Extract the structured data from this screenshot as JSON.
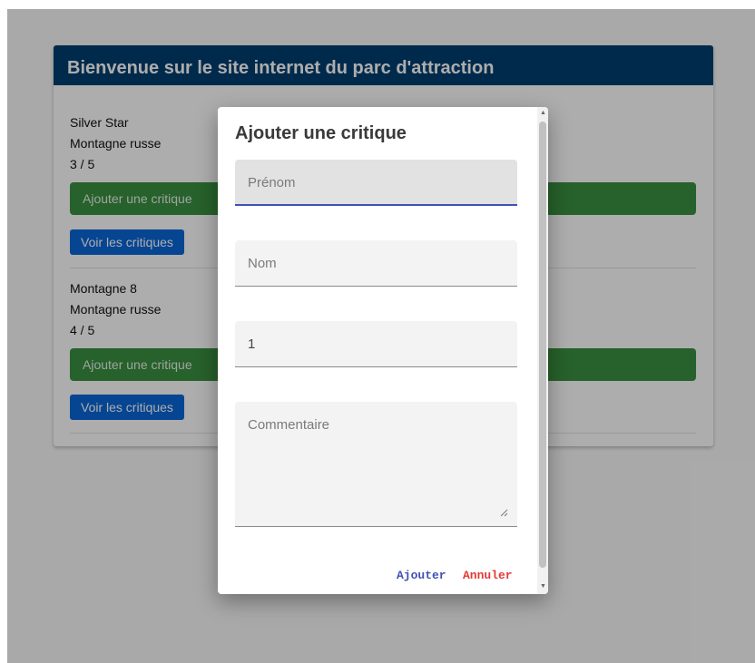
{
  "page": {
    "title": "Bienvenue sur le site internet du parc d'attraction",
    "attractions": [
      {
        "name": "Silver Star",
        "type": "Montagne russe",
        "rating": "3 / 5",
        "add_label": "Ajouter une critique",
        "view_label": "Voir les critiques"
      },
      {
        "name": "Montagne 8",
        "type": "Montagne russe",
        "rating": "4 / 5",
        "add_label": "Ajouter une critique",
        "view_label": "Voir les critiques"
      }
    ]
  },
  "dialog": {
    "title": "Ajouter une critique",
    "fields": {
      "prenom": {
        "placeholder": "Prénom",
        "value": ""
      },
      "nom": {
        "placeholder": "Nom",
        "value": ""
      },
      "note": {
        "placeholder": "",
        "value": "1"
      },
      "commentaire": {
        "placeholder": "Commentaire",
        "value": ""
      }
    },
    "actions": {
      "submit_label": "Ajouter",
      "cancel_label": "Annuler"
    }
  },
  "colors": {
    "header_bg": "#003f70",
    "add_button": "#3a8f40",
    "view_button": "#0a66d8",
    "focus_underline": "#3f51b5",
    "submit_text": "#3f51b5",
    "cancel_text": "#e53935"
  }
}
